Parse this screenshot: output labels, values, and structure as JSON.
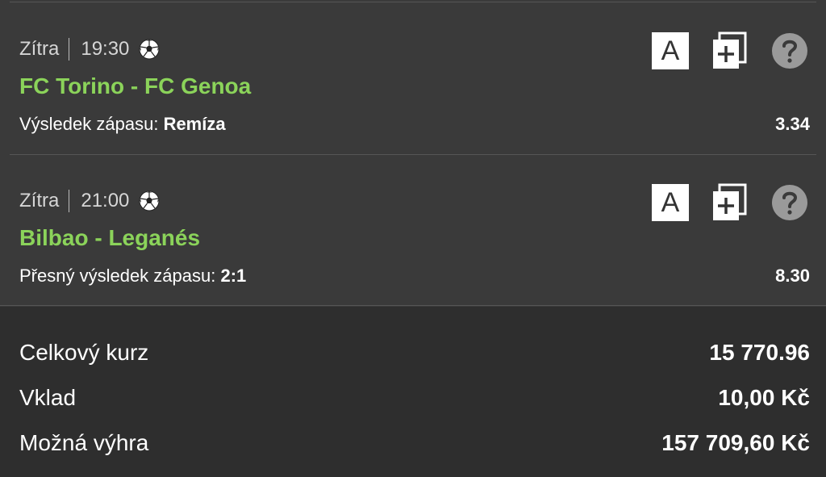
{
  "bets": [
    {
      "day": "Zítra",
      "time": "19:30",
      "sport_icon": "soccer-ball-icon",
      "match": "FC Torino - FC Genoa",
      "market_label": "Výsledek zápasu:",
      "selection": "Remíza",
      "odds": "3.34"
    },
    {
      "day": "Zítra",
      "time": "21:00",
      "sport_icon": "soccer-ball-icon",
      "match": "Bilbao - Leganés",
      "market_label": "Přesný výsledek zápasu:",
      "selection": "2:1",
      "odds": "8.30"
    }
  ],
  "icons": {
    "a_label": "A"
  },
  "summary": {
    "total_odds_label": "Celkový kurz",
    "total_odds_value": "15 770.96",
    "stake_label": "Vklad",
    "stake_value": "10,00 Kč",
    "win_label": "Možná výhra",
    "win_value": "157 709,60 Kč"
  },
  "colors": {
    "match_green": "#8bd35a",
    "background": "#3a3a3a",
    "summary_background": "#2e2e2e"
  }
}
